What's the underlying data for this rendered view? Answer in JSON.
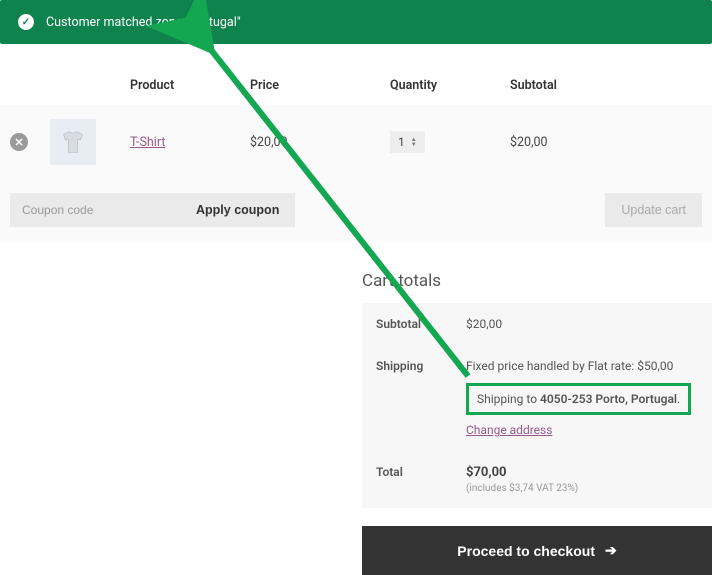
{
  "notice": {
    "text": "Customer matched zone \"Portugal\""
  },
  "columns": {
    "product": "Product",
    "price": "Price",
    "quantity": "Quantity",
    "subtotal": "Subtotal"
  },
  "item": {
    "name": "T-Shirt",
    "price": "$20,00",
    "qty": "1",
    "subtotal": "$20,00"
  },
  "coupon": {
    "placeholder": "Coupon code",
    "apply": "Apply coupon"
  },
  "update_cart": "Update cart",
  "totals": {
    "heading": "Cart totals",
    "subtotal_label": "Subtotal",
    "subtotal_value": "$20,00",
    "shipping_label": "Shipping",
    "shipping_method": "Fixed price handled by Flat rate: $50,00",
    "shipping_to_prefix": "Shipping to ",
    "shipping_to_bold": "4050-253 Porto, Portugal",
    "shipping_to_suffix": ".",
    "change_address": "Change address",
    "total_label": "Total",
    "total_value": "$70,00",
    "vat_note": "(includes $3,74 VAT 23%)"
  },
  "checkout": "Proceed to checkout"
}
